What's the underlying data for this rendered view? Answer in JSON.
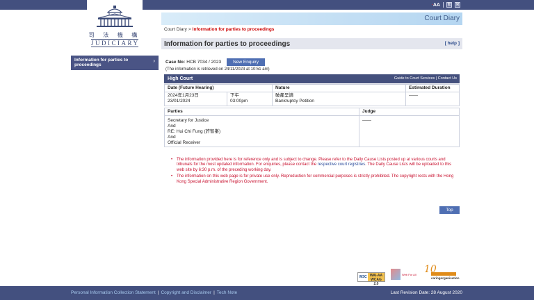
{
  "brand": {
    "logo_cn": "司 法 機 構",
    "logo_en": "JUDICIARY"
  },
  "tools": {
    "font_size_label": "AA",
    "lang_label": "繁",
    "alt_label": "简"
  },
  "header": {
    "title": "Court Diary"
  },
  "breadcrumb": {
    "root": "Court Diary",
    "separator": ">",
    "current": "Information for parties to proceedings"
  },
  "page": {
    "title": "Information for parties to proceedings",
    "help_label": "[ help ]"
  },
  "sidebar": {
    "items": [
      {
        "label": "Information for parties to proceedings"
      }
    ]
  },
  "case": {
    "label": "Case No:",
    "number": "HCB 7034 / 2023",
    "enquiry_button": "New Enquiry",
    "retrieved_note": "(The information is retrieved on 24/11/2023 at 10:51 am)"
  },
  "court": {
    "name": "High Court",
    "links": "Guide to Court Services | Contact Us"
  },
  "hearing_table": {
    "headers": [
      "Date (Future Hearing)",
      "Nature",
      "Estimated Duration"
    ],
    "rows": [
      {
        "date_cn": "2024年1月23日",
        "date_en": "23/01/2024",
        "time_cn": "下午",
        "time_en": "03:00pm",
        "nature_cn": "破產呈請",
        "nature_en": "Bankruptcy Petition",
        "duration": "——"
      }
    ]
  },
  "parties_table": {
    "headers": [
      "Parties",
      "Judge"
    ],
    "parties_lines": [
      "Secretary for Justice",
      "And",
      "RE: Hui Chi Fung (許智峯)",
      "And",
      "Official Receiver"
    ],
    "judge": "——"
  },
  "notes": {
    "note1_a": "The information provided here is for reference only and is subject to change. Please refer to the Daily Cause Lists posted up at various courts and tribunals for the most updated information. For enquiries, please contact the ",
    "note1_link": "respective court registries",
    "note1_b": ". The Daily Cause Lists will be uploaded to this web site by 6:30 p.m. of the preceding working day.",
    "note2": "The information on this web page is for private use only. Reproduction for commercial purposes is strictly prohibited. The copyright rests with the Hong Kong Special Administrative Region Government."
  },
  "top_button": "Top",
  "badges": {
    "w3c_left": "W3C",
    "w3c_right_1": "WAI-AA",
    "w3c_right_2": "WCAG 2.0",
    "web_for_all": "Web For All",
    "caring_big": "10",
    "caring_text": "caringorganisation"
  },
  "footer": {
    "links": [
      "Personal Information Collection Statement",
      "Copyright and Disclaimer",
      "Tech Note"
    ],
    "separator": "|",
    "revision": "Last Revision Date: 28 August 2020"
  },
  "colors": {
    "navy": "#43507f",
    "accent_red": "#c8102e",
    "button_blue": "#4f6fb3"
  }
}
